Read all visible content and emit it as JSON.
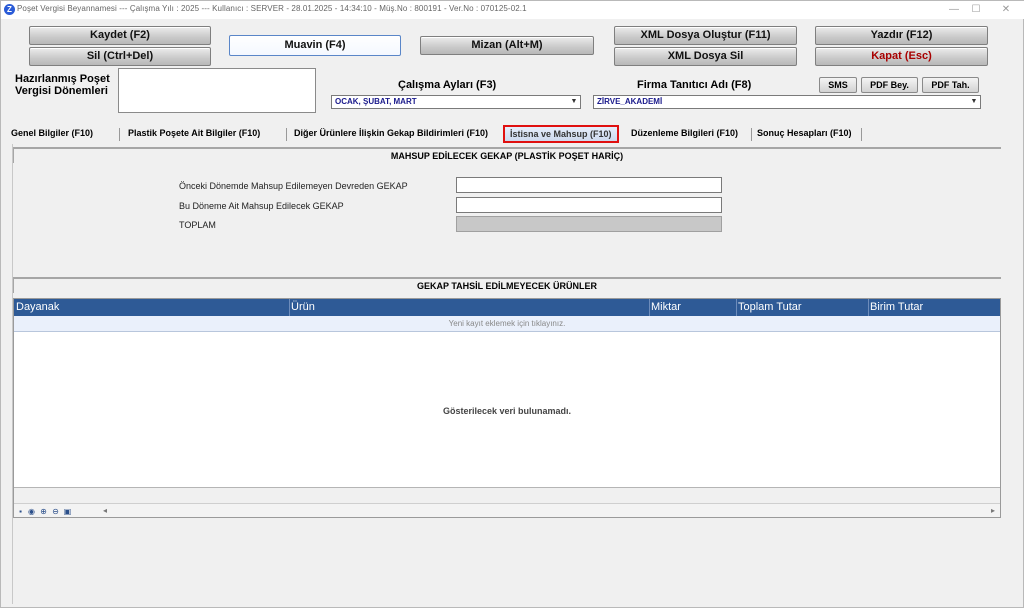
{
  "window": {
    "title": "Poşet Vergisi Beyannamesi  ---  Çalışma Yılı : 2025  ---  Kullanıcı : SERVER - 28.01.2025 - 14:34:10 - Müş.No : 800191 - Ver.No : 070125-02.1",
    "icon_letter": "Z",
    "minimize_symbol": "—",
    "maximize_symbol": "☐",
    "close_symbol": "✕"
  },
  "toolbar": {
    "kaydet": "Kaydet (F2)",
    "sil": "Sil (Ctrl+Del)",
    "muavin": "Muavin (F4)",
    "mizan": "Mizan (Alt+M)",
    "xml_olustur": "XML Dosya Oluştur (F11)",
    "xml_sil": "XML Dosya Sil",
    "yazdir": "Yazdır (F12)",
    "kapat": "Kapat (Esc)"
  },
  "header": {
    "prepared_periods_label": "Hazırlanmış Poşet Vergisi Dönemleri",
    "working_months_label": "Çalışma Ayları (F3)",
    "working_months_value": "OCAK, ŞUBAT, MART",
    "company_label": "Firma Tanıtıcı Adı (F8)",
    "company_value": "ZİRVE_AKADEMİ",
    "sms": "SMS",
    "pdf_bey": "PDF Bey.",
    "pdf_tah": "PDF Tah."
  },
  "tabs": [
    {
      "label": "Genel Bilgiler (F10)"
    },
    {
      "label": "Plastik Poşete Ait Bilgiler (F10)"
    },
    {
      "label": "Diğer Ürünlere İlişkin Gekap Bildirimleri (F10)"
    },
    {
      "label": "İstisna ve Mahsup (F10)"
    },
    {
      "label": "Düzenleme Bilgileri (F10)"
    },
    {
      "label": "Sonuç Hesapları (F10)"
    }
  ],
  "mahsup": {
    "title": "MAHSUP EDİLECEK GEKAP (PLASTİK POŞET HARİÇ)",
    "field1_label": "Önceki Dönemde Mahsup Edilemeyen Devreden GEKAP",
    "field1_value": "",
    "field2_label": "Bu Döneme Ait Mahsup Edilecek GEKAP",
    "field2_value": "",
    "total_label": "TOPLAM",
    "total_value": ""
  },
  "grid": {
    "title": "GEKAP TAHSİL EDİLMEYECEK ÜRÜNLER",
    "columns": [
      "Dayanak",
      "Ürün",
      "Miktar",
      "Toplam Tutar",
      "Birim Tutar"
    ],
    "new_row_hint": "Yeni kayıt eklemek için tıklayınız.",
    "empty_message": "Gösterilecek veri bulunamadı."
  },
  "colors": {
    "grid_header": "#2e5a96",
    "active_tab_border": "#e01010",
    "kapat_text": "#a80000"
  }
}
